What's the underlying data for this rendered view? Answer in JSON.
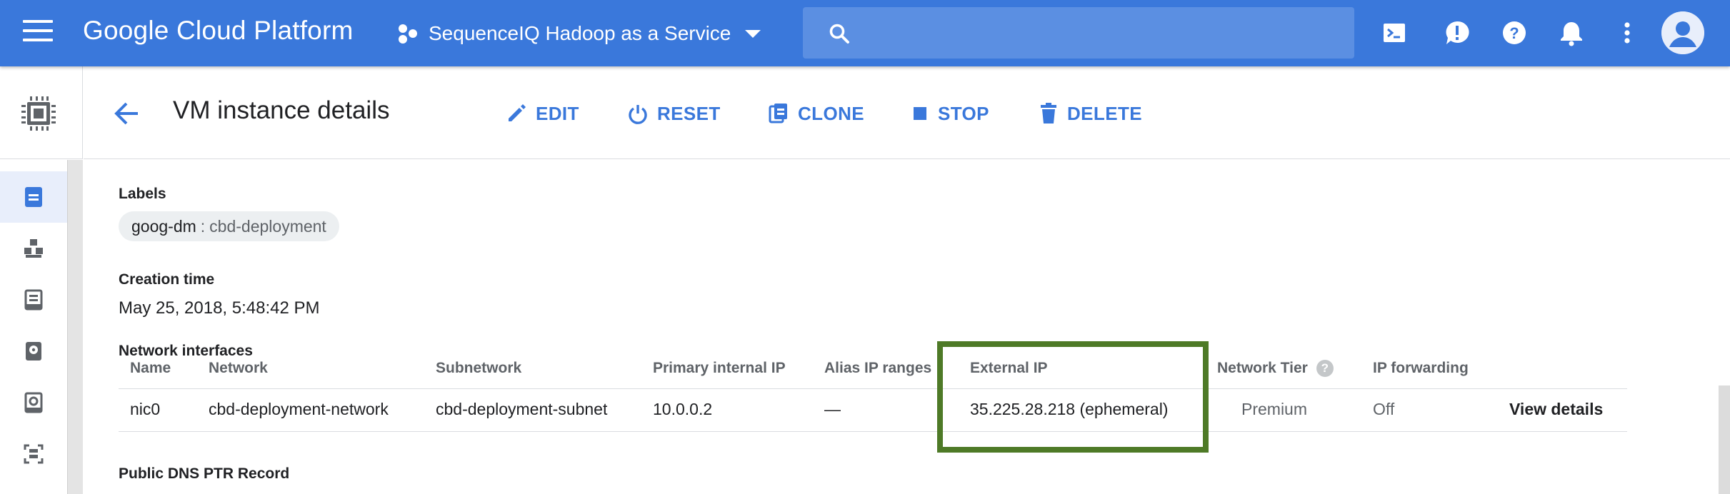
{
  "topbar": {
    "title": "Google Cloud Platform",
    "project_name": "SequenceIQ Hadoop as a Service",
    "search_placeholder": "",
    "icons": [
      "terminal-icon",
      "alert-icon",
      "help-icon",
      "bell-icon",
      "more-vert-icon",
      "avatar-icon"
    ],
    "background_color": "#3a78db"
  },
  "rail": {
    "logo_icon": "compute-chip-icon",
    "items": [
      {
        "icon": "vm-instances-icon",
        "active": true
      },
      {
        "icon": "instance-groups-icon",
        "active": false
      },
      {
        "icon": "instance-templates-icon",
        "active": false
      },
      {
        "icon": "disks-icon",
        "active": false
      },
      {
        "icon": "snapshots-icon",
        "active": false
      },
      {
        "icon": "images-icon",
        "active": false
      }
    ]
  },
  "header": {
    "page_title": "VM instance details",
    "actions": [
      {
        "label": "EDIT",
        "icon": "pencil-icon"
      },
      {
        "label": "RESET",
        "icon": "power-icon"
      },
      {
        "label": "CLONE",
        "icon": "clone-icon"
      },
      {
        "label": "STOP",
        "icon": "stop-icon"
      },
      {
        "label": "DELETE",
        "icon": "trash-icon"
      }
    ],
    "accent_color": "#3a78db"
  },
  "details": {
    "labels_heading": "Labels",
    "label_chip": {
      "key": "goog-dm",
      "separator": ":",
      "value": "cbd-deployment"
    },
    "creation_heading": "Creation time",
    "creation_value": "May 25, 2018, 5:48:42 PM",
    "network_heading": "Network interfaces",
    "dns_heading": "Public DNS PTR Record"
  },
  "network_table": {
    "columns": [
      "Name",
      "Network",
      "Subnetwork",
      "Primary internal IP",
      "Alias IP ranges",
      "External IP",
      "Network Tier",
      "IP forwarding"
    ],
    "rows": [
      {
        "name": "nic0",
        "network": "cbd-deployment-network",
        "subnetwork": "cbd-deployment-subnet",
        "primary_internal_ip": "10.0.0.2",
        "alias_ip_ranges": "—",
        "external_ip": "35.225.28.218 (ephemeral)",
        "network_tier": "Premium",
        "ip_forwarding": "Off",
        "action": "View details"
      }
    ],
    "help_glyph": "?",
    "highlight_color": "#4e7a27"
  }
}
